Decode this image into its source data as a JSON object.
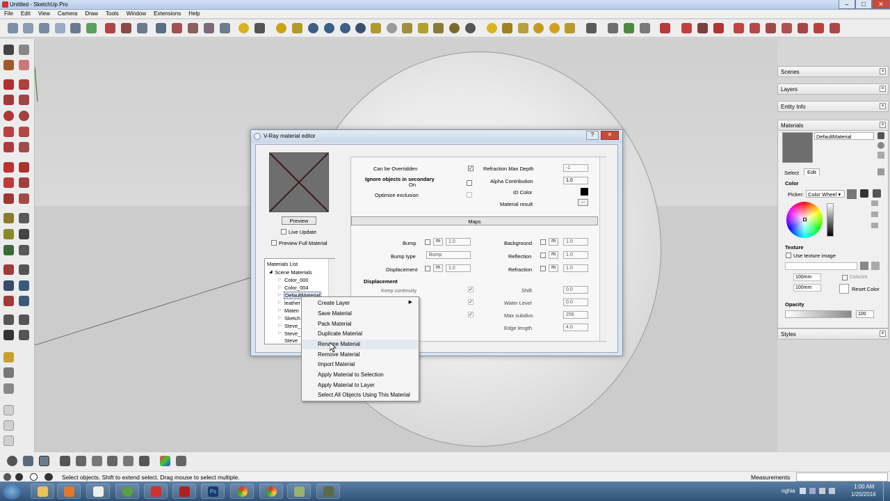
{
  "window": {
    "title": "Untitled - SketchUp Pro"
  },
  "menu": [
    "File",
    "Edit",
    "View",
    "Camera",
    "Draw",
    "Tools",
    "Window",
    "Extensions",
    "Help"
  ],
  "tray": {
    "panels": [
      "Scenes",
      "Layers",
      "Entity Info",
      "Materials"
    ],
    "styles_label": "Styles",
    "materials": {
      "name": "DefaultMaterial",
      "tab_select": "Select",
      "tab_edit": "Edit",
      "color_label": "Color",
      "picker_label": "Picker:",
      "picker_value": "Color Wheel",
      "texture_label": "Texture",
      "use_texture_label": "Use texture image",
      "width_value": "100mm",
      "height_value": "100mm",
      "colorize_label": "Colorize",
      "reset_color_label": "Reset Color",
      "opacity_label": "Opacity",
      "opacity_value": "100"
    }
  },
  "vray": {
    "title": "V-Ray material editor",
    "preview_button": "Preview",
    "live_update": "Live Update",
    "preview_full": "Preview Full Material",
    "materials_list_title": "Materials List",
    "tree": {
      "root": "Scene Materials",
      "items": [
        "Color_000",
        "Color_004",
        "DefaultMaterial",
        "leather",
        "Materi",
        "Sketch",
        "Steve_E",
        "Steve_E",
        "Steve_S"
      ]
    },
    "options": {
      "can_be_overridden": "Can be Overridden",
      "ignore_secondary": "Ignore objects in secondary",
      "on_label": "On",
      "optimize_exclusion": "Optimize exclusion",
      "refraction_max_depth": "Refraction Max Depth",
      "refraction_max_depth_value": "-1",
      "alpha_contribution": "Alpha Contribution",
      "alpha_contribution_value": "1.0",
      "id_color": "ID Color",
      "material_result": "Material result",
      "material_result_btn": "..."
    },
    "maps_header": "Maps",
    "maps_left": [
      {
        "label": "Bump",
        "m": "m",
        "value": "1.0"
      },
      {
        "label": "Bump type",
        "value": "Bump"
      },
      {
        "label": "Displacement",
        "m": "m",
        "value": "1.0"
      }
    ],
    "maps_right": [
      {
        "label": "Background",
        "m": "m",
        "value": "1.0"
      },
      {
        "label": "Reflection",
        "m": "m",
        "value": "1.0"
      },
      {
        "label": "Refraction",
        "m": "m",
        "value": "1.0"
      }
    ],
    "displacement": {
      "header": "Displacement",
      "keep_continuity": "Keep continuity",
      "shift": "Shift",
      "shift_value": "0.0",
      "water_level": "Water Level",
      "water_level_value": "0.0",
      "max_subdivs": "Max subdivs",
      "max_subdivs_value": "256",
      "edge_length": "Edge length",
      "edge_length_value": "4.0"
    }
  },
  "context_menu": {
    "items": [
      "Create Layer",
      "Save Material",
      "Pack Material",
      "Duplicate Material",
      "Rename Material",
      "Remove Material",
      "Import Material",
      "Apply Material to Selection",
      "Apply Material to Layer",
      "Select All Objects Using This Material"
    ],
    "highlighted_index": 4
  },
  "status": {
    "message": "Select objects. Shift to extend select. Drag mouse to select multiple.",
    "measurements_label": "Measurements"
  },
  "taskbar": {
    "user": "nghia",
    "time": "1:00 AM",
    "date": "1/20/2016"
  },
  "colors": {
    "titlebar": "#c3d6ec",
    "material_swatch": "#6e6e6e",
    "taskbar": "#3d6289"
  }
}
